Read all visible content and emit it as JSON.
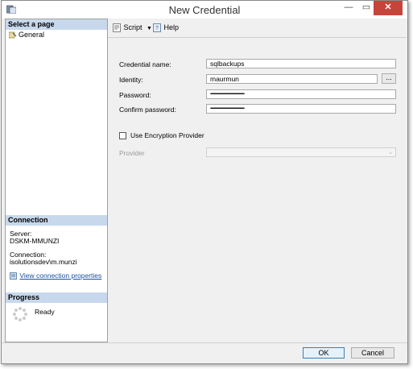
{
  "window": {
    "title": "New Credential",
    "close_glyph": "✕",
    "min_glyph": "—",
    "max_glyph": "▭"
  },
  "left": {
    "select_page_header": "Select a page",
    "pages": [
      {
        "label": "General",
        "icon": "wrench-icon"
      }
    ],
    "connection_header": "Connection",
    "server_label": "Server:",
    "server_value": "DSKM-MMUNZI",
    "connection_label": "Connection:",
    "connection_value": "isolutionsdev\\m.munzi",
    "view_props_link": "View connection properties",
    "progress_header": "Progress",
    "progress_status": "Ready"
  },
  "toolbar": {
    "script_label": "Script",
    "help_label": "Help"
  },
  "form": {
    "credential_name_label": "Credential name:",
    "credential_name_value": "sqlbackups",
    "identity_label": "Identity:",
    "identity_value": "maurmun",
    "browse_label": "...",
    "password_label": "Password:",
    "password_value": "••••••••••••••••••••••••••••••••••••••••••••••••••••••••",
    "confirm_password_label": "Confirm password:",
    "confirm_password_value": "••••••••••••••••••••••••••••••••••••••••••••••••••••••••",
    "use_encryption_label": "Use Encryption Provider",
    "use_encryption_checked": false,
    "provider_label": "Provider",
    "provider_value": ""
  },
  "buttons": {
    "ok_label": "OK",
    "cancel_label": "Cancel"
  },
  "colors": {
    "close_button": "#c7443a",
    "section_header": "#c8d8ec",
    "link": "#1a4fa0"
  }
}
